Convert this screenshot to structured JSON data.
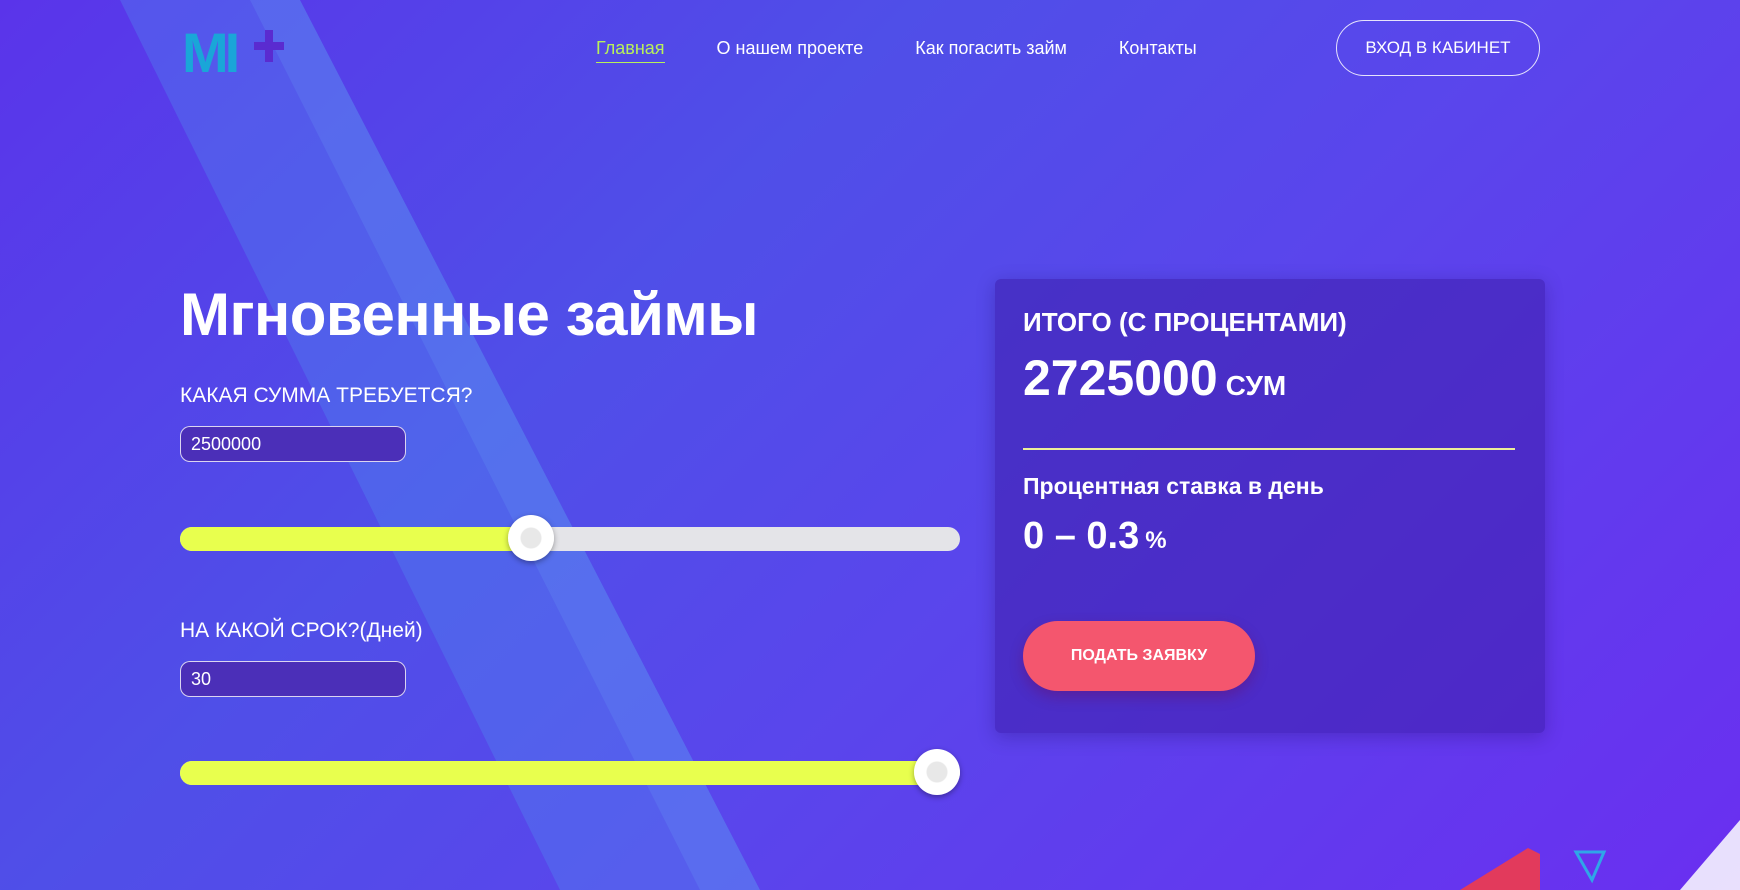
{
  "header": {
    "logo_text": "MI+",
    "nav": [
      {
        "label": "Главная",
        "active": true
      },
      {
        "label": "О нашем проекте",
        "active": false
      },
      {
        "label": "Как погасить займ",
        "active": false
      },
      {
        "label": "Контакты",
        "active": false
      }
    ],
    "login_label": "ВХОД В КАБИНЕТ"
  },
  "calculator": {
    "title": "Мгновенные займы",
    "amount_label": "КАКАЯ СУММА ТРЕБУЕТСЯ?",
    "amount_value": "2500000",
    "amount_slider_fraction": 0.45,
    "term_label": "НА КАКОЙ СРОК?(Дней)",
    "term_value": "30",
    "term_slider_fraction": 0.97
  },
  "summary": {
    "total_label": "ИТОГО (С ПРОЦЕНТАМИ)",
    "total_value": "2725000",
    "total_unit": "СУМ",
    "rate_label": "Процентная ставка в день",
    "rate_value": "0 – 0.3",
    "rate_unit": "%",
    "apply_label": "ПОДАТЬ ЗАЯВКУ"
  },
  "colors": {
    "accent_yellow": "#e8ff4e",
    "active_nav": "#b8f05a",
    "apply_button": "#f4566e",
    "logo_cyan": "#1aa6d8",
    "logo_purple": "#5a2bd0"
  }
}
